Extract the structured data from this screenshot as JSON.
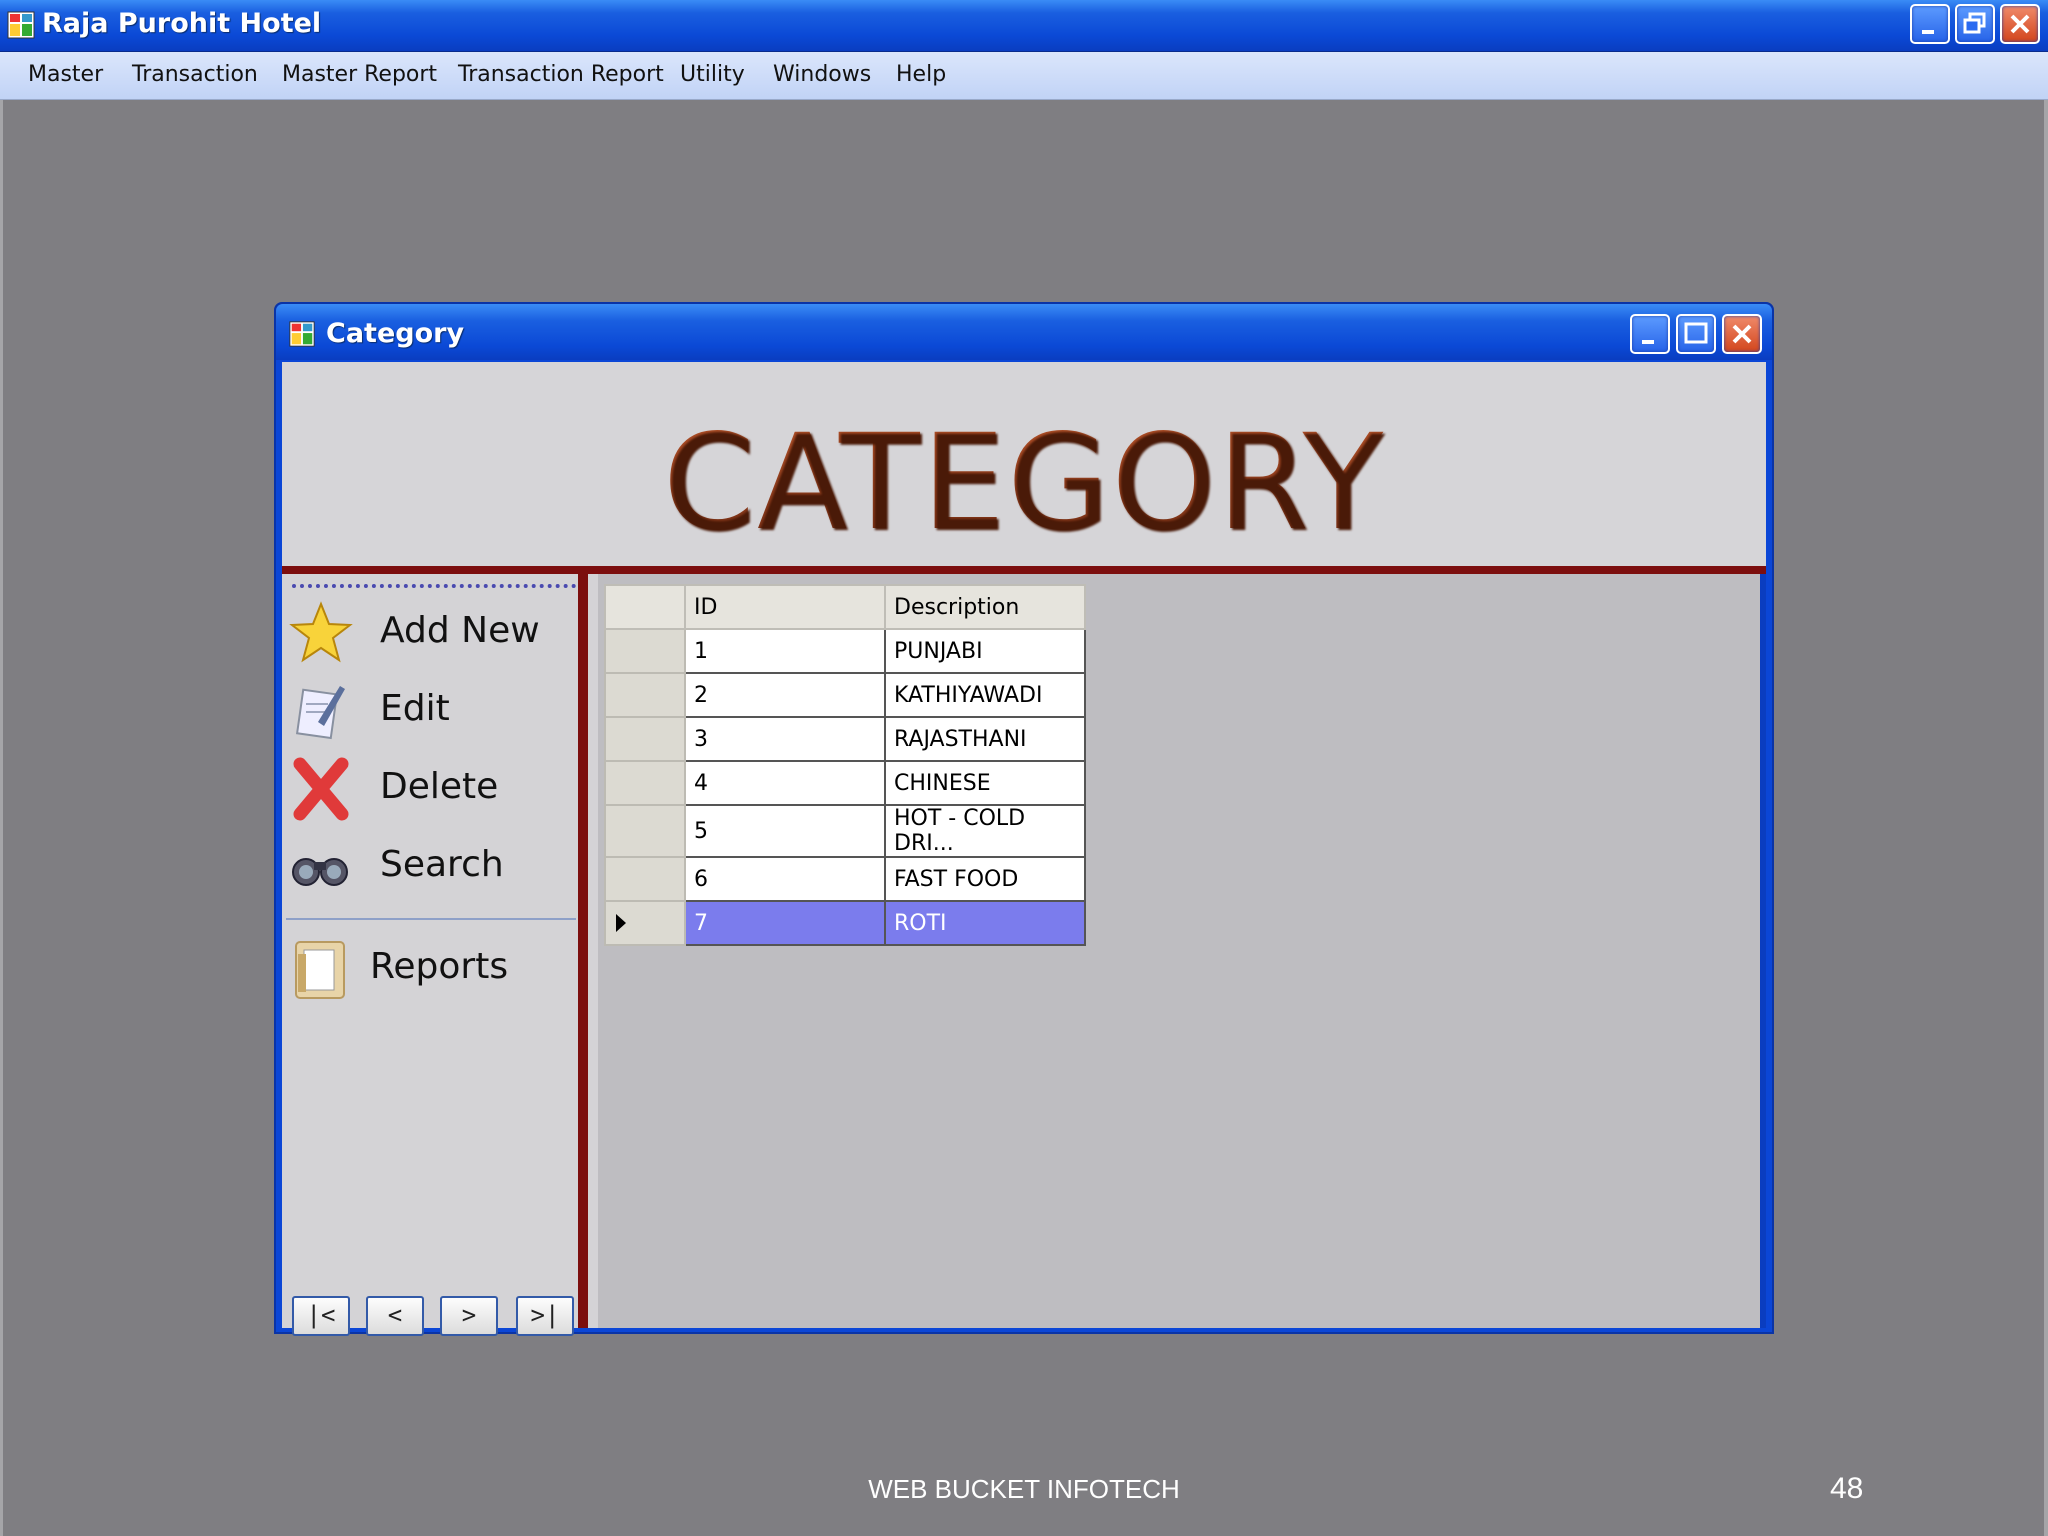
{
  "app": {
    "title": "Raja Purohit Hotel",
    "menu": [
      "Master",
      "Transaction",
      "Master Report",
      "Transaction Report",
      "Utility",
      "Windows",
      "Help"
    ]
  },
  "child_window": {
    "title": "Category",
    "banner": "CATEGORY"
  },
  "commands": {
    "add_new": "Add New",
    "edit": "Edit",
    "delete": "Delete",
    "search": "Search",
    "reports": "Reports"
  },
  "nav_buttons": [
    "|<",
    "<",
    ">",
    ">|"
  ],
  "grid": {
    "columns": [
      "ID",
      "Description"
    ],
    "rows": [
      {
        "id": "1",
        "description": "PUNJABI"
      },
      {
        "id": "2",
        "description": "KATHIYAWADI"
      },
      {
        "id": "3",
        "description": "RAJASTHANI"
      },
      {
        "id": "4",
        "description": "CHINESE"
      },
      {
        "id": "5",
        "description": "HOT - COLD DRI..."
      },
      {
        "id": "6",
        "description": "FAST FOOD"
      },
      {
        "id": "7",
        "description": "ROTI"
      }
    ],
    "selected_row": 7
  },
  "footer": {
    "text": "WEB BUCKET INFOTECH",
    "page_number": "48"
  },
  "colors": {
    "title_bar": "#0b49d6",
    "accent_maroon": "#7c0e0e",
    "selection": "#7b7ced",
    "desktop": "#7f7e82"
  }
}
